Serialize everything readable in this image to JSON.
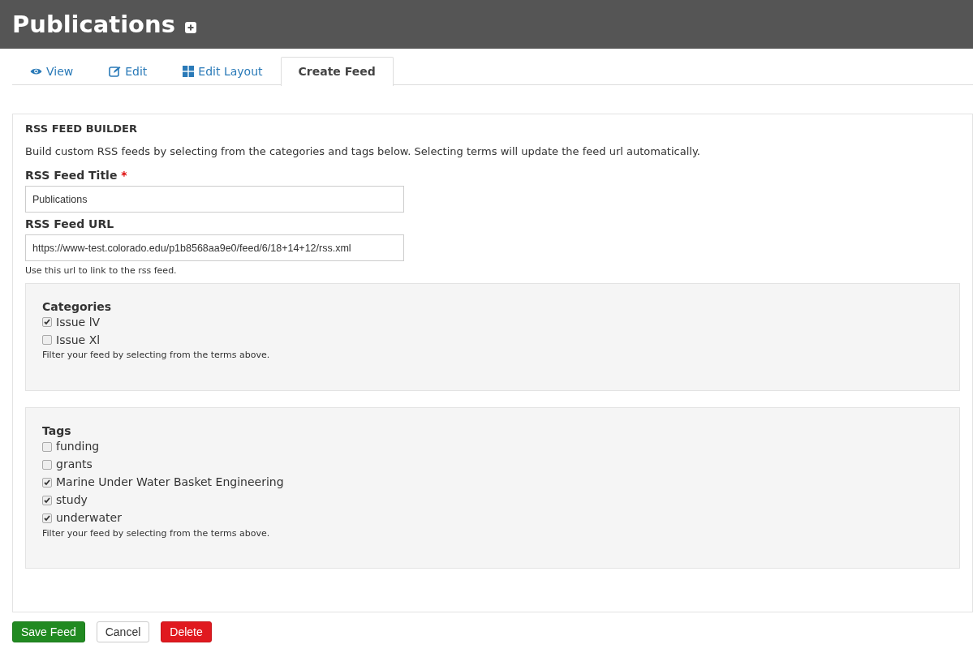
{
  "page": {
    "title": "Publications"
  },
  "tabs": [
    {
      "label": "View",
      "kind": "eye",
      "selected": false
    },
    {
      "label": "Edit",
      "kind": "pencil",
      "selected": false
    },
    {
      "label": "Edit Layout",
      "kind": "grid",
      "selected": false
    },
    {
      "label": "Create Feed",
      "kind": "plain",
      "selected": true
    }
  ],
  "builder": {
    "heading": "RSS FEED BUILDER",
    "intro": "Build custom RSS feeds by selecting from the categories and tags below. Selecting terms will update the feed url automatically.",
    "title_field": {
      "label": "RSS Feed Title",
      "required_mark": "*",
      "value": "Publications"
    },
    "url_field": {
      "label": "RSS Feed URL",
      "value": "https://www-test.colorado.edu/p1b8568aa9e0/feed/6/18+14+12/rss.xml",
      "help": "Use this url to link to the rss feed."
    },
    "groups": [
      {
        "title": "Categories",
        "help": "Filter your feed by selecting from the terms above.",
        "terms": [
          {
            "label": "Issue lV",
            "checked": true
          },
          {
            "label": "Issue Xl",
            "checked": false
          }
        ]
      },
      {
        "title": "Tags",
        "help": "Filter your feed by selecting from the terms above.",
        "terms": [
          {
            "label": "funding",
            "checked": false
          },
          {
            "label": "grants",
            "checked": false
          },
          {
            "label": "Marine Under Water Basket Engineering",
            "checked": true
          },
          {
            "label": "study",
            "checked": true
          },
          {
            "label": "underwater",
            "checked": true
          }
        ]
      }
    ]
  },
  "buttons": [
    {
      "label": "Save Feed",
      "kind": "save"
    },
    {
      "label": "Cancel",
      "kind": "cancel"
    },
    {
      "label": "Delete",
      "kind": "delete"
    }
  ]
}
